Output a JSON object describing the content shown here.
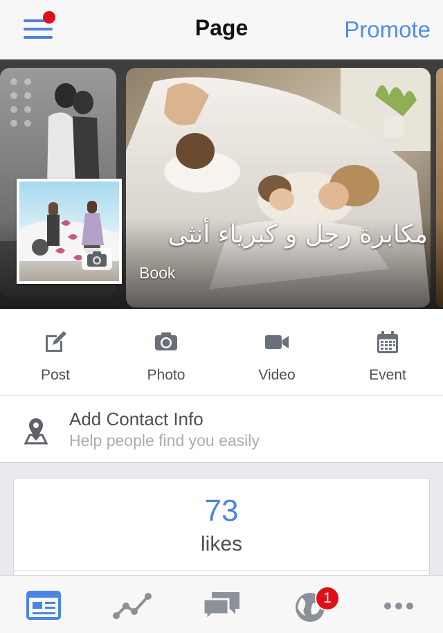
{
  "nav": {
    "title": "Page",
    "promote_label": "Promote"
  },
  "cover": {
    "page_name": "مكابرة رجل و كبرياء أنثى",
    "category": "Book"
  },
  "actions": [
    {
      "label": "Post",
      "icon": "edit-icon"
    },
    {
      "label": "Photo",
      "icon": "camera-icon"
    },
    {
      "label": "Video",
      "icon": "video-icon"
    },
    {
      "label": "Event",
      "icon": "calendar-icon"
    }
  ],
  "contact": {
    "title": "Add Contact Info",
    "subtitle": "Help people find you easily"
  },
  "likes": {
    "count": "73",
    "label": "likes"
  },
  "tabs": [
    {
      "name": "news-feed-icon",
      "active": true
    },
    {
      "name": "insights-icon"
    },
    {
      "name": "messages-icon"
    },
    {
      "name": "notifications-globe-icon",
      "badge": "1"
    },
    {
      "name": "more-icon"
    }
  ],
  "colors": {
    "accent": "#4f8ee8",
    "badge": "#e0101a",
    "icon_gray": "#6a7079"
  }
}
